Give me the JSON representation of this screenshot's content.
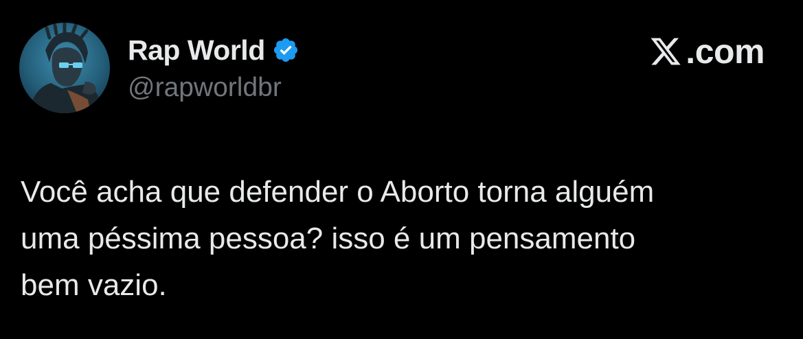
{
  "tweet": {
    "author": {
      "display_name": "Rap World",
      "handle": "@rapworldbr",
      "verified": true,
      "avatar_icon": "artist-avatar"
    },
    "brand": {
      "logo_icon": "x-logo-icon",
      "domain": ".com"
    },
    "text_lines": [
      "Você acha que defender o Aborto torna alguém",
      "uma péssima pessoa? isso é um pensamento",
      "bem vazio."
    ]
  },
  "colors": {
    "background": "#000000",
    "primary_text": "#e7e9ea",
    "secondary_text": "#71767b",
    "verified_blue": "#1d9bf0"
  }
}
